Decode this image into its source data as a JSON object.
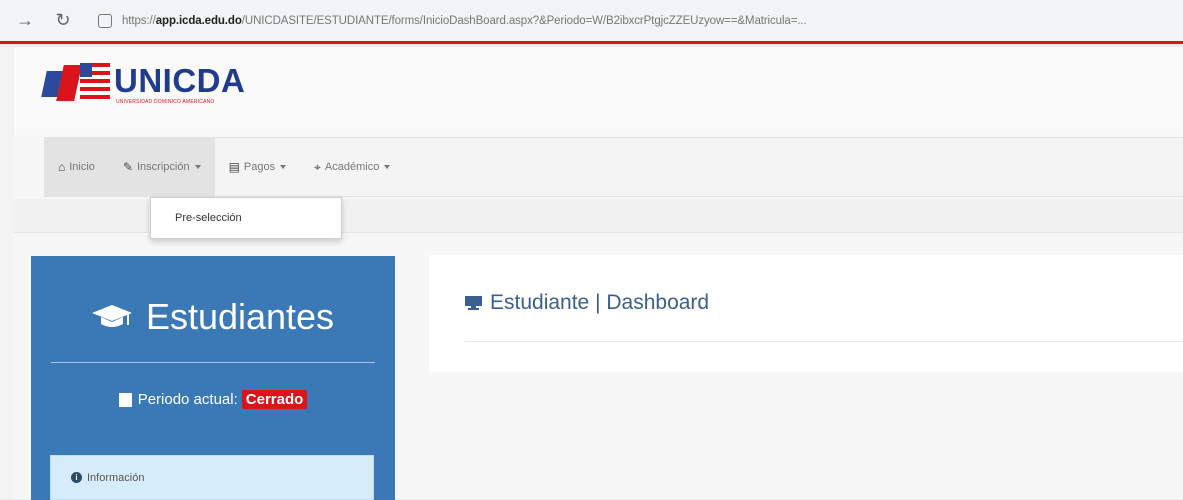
{
  "browser": {
    "url_prefix": "https://",
    "url_host": "app.icda.edu.do",
    "url_path": "/UNICDASITE/ESTUDIANTE/forms/InicioDashBoard.aspx?&Periodo=W/B2ibxcrPtgjcZZEUzyow==&Matricula=..."
  },
  "logo": {
    "name": "UNICDA",
    "subtitle": "UNIVERSIDAD DOMINICO AMERICANO"
  },
  "navbar": {
    "items": [
      {
        "label": "Inicio",
        "icon": "home-icon",
        "has_caret": false
      },
      {
        "label": "Inscripción",
        "icon": "pencil-icon",
        "has_caret": true
      },
      {
        "label": "Pagos",
        "icon": "money-icon",
        "has_caret": true
      },
      {
        "label": "Académico",
        "icon": "graduation-cap-icon",
        "has_caret": true
      }
    ]
  },
  "dropdown": {
    "items": [
      {
        "label": "Pre-selección"
      }
    ]
  },
  "sidebar": {
    "title": "Estudiantes",
    "period_label": "Periodo actual:",
    "period_status": "Cerrado",
    "info_label": "Información"
  },
  "main": {
    "title": "Estudiante | Dashboard"
  },
  "colors": {
    "sidebar_bg": "#3a78b6",
    "accent_red": "#d9141a",
    "logo_blue": "#1f3c8f",
    "title_blue": "#3a5f8f"
  }
}
